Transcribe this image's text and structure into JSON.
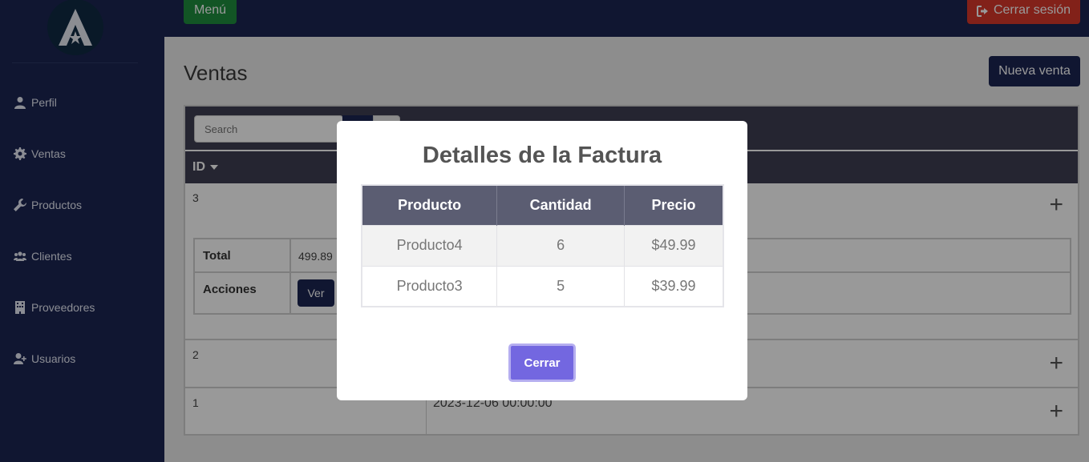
{
  "topbar": {
    "menu_label": "Menú",
    "logout_label": "Cerrar sesión"
  },
  "sidebar": {
    "items": [
      {
        "label": "Perfil",
        "icon": "user-icon"
      },
      {
        "label": "Ventas",
        "icon": "gear-icon"
      },
      {
        "label": "Productos",
        "icon": "wrench-icon"
      },
      {
        "label": "Clientes",
        "icon": "users-icon"
      },
      {
        "label": "Proveedores",
        "icon": "building-icon"
      },
      {
        "label": "Usuarios",
        "icon": "user-plus-icon"
      }
    ]
  },
  "main": {
    "title": "Ventas",
    "new_button": "Nueva venta",
    "search_placeholder": "Search",
    "column_id": "ID",
    "rows": [
      {
        "id": "3",
        "date": ""
      },
      {
        "id": "2",
        "date": ""
      },
      {
        "id": "1",
        "date": "2023-12-06 00:00:00"
      }
    ],
    "detail": {
      "total_label": "Total",
      "total_value": "499.89",
      "actions_label": "Acciones",
      "view_button": "Ver"
    }
  },
  "modal": {
    "title": "Detalles de la Factura",
    "headers": [
      "Producto",
      "Cantidad",
      "Precio"
    ],
    "items": [
      {
        "producto": "Producto4",
        "cantidad": "6",
        "precio": "$49.99"
      },
      {
        "producto": "Producto3",
        "cantidad": "5",
        "precio": "$39.99"
      }
    ],
    "close_button": "Cerrar"
  },
  "colors": {
    "primary": "#1b2552",
    "menu_green": "#1e8e3e",
    "logout_red": "#d9372a",
    "close_purple": "#7367e0"
  }
}
